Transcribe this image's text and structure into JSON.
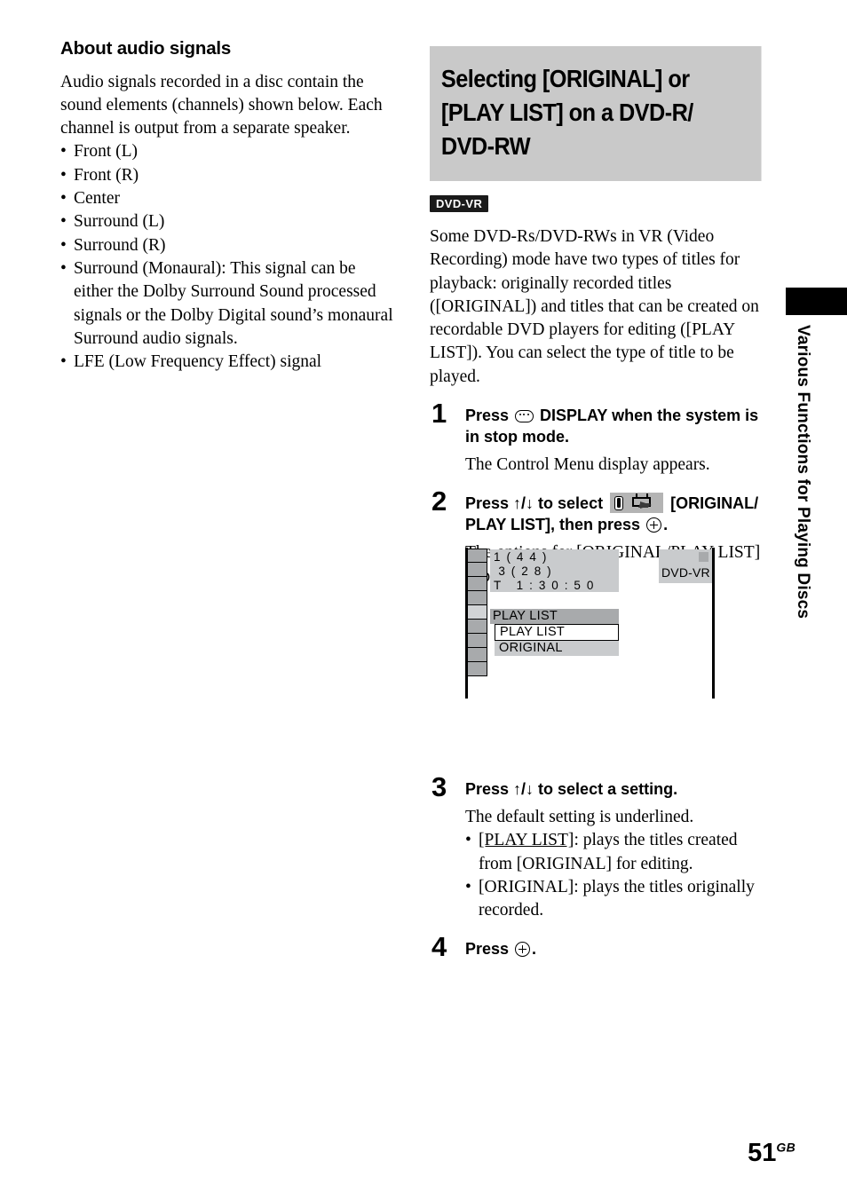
{
  "left_column": {
    "heading": "About audio signals",
    "intro": "Audio signals recorded in a disc contain the sound elements (channels) shown below. Each channel is output from a separate speaker.",
    "channels": [
      "Front (L)",
      "Front (R)",
      "Center",
      "Surround (L)",
      "Surround (R)",
      "Surround (Monaural): This signal can be either the Dolby Surround Sound processed signals or the Dolby Digital sound’s monaural Surround audio signals.",
      "LFE (Low Frequency Effect) signal"
    ]
  },
  "right_column": {
    "section_title": "Selecting [ORIGINAL] or [PLAY LIST] on a DVD-R/ DVD-RW",
    "disc_badge": "DVD-VR",
    "intro": "Some DVD-Rs/DVD-RWs in VR (Video Recording) mode have two types of titles for playback: originally recorded titles ([ORIGINAL]) and titles that can be created on recordable DVD players for editing ([PLAY LIST]). You can select the type of title to be played.",
    "steps": [
      {
        "number": "1",
        "head_before_icon": "Press ",
        "icon": "display-button-icon",
        "head_after_icon": " DISPLAY when the system is in stop mode.",
        "body": "The Control Menu display appears."
      },
      {
        "number": "2",
        "head_part1": "Press ↑/↓ to select ",
        "icon": "original-playlist-icon",
        "head_part2": " [ORIGINAL/ PLAY LIST], then press ",
        "icon2": "enter-button-icon",
        "head_part3": ".",
        "body": "The options for [ORIGINAL/PLAY LIST] appear."
      },
      {
        "number": "3",
        "head": "Press ↑/↓ to select a setting.",
        "body": "The default setting is underlined.",
        "options": [
          {
            "name": "[PLAY LIST]",
            "underlined": true,
            "desc": ": plays the titles created from [ORIGINAL] for editing."
          },
          {
            "name": "[ORIGINAL]",
            "underlined": false,
            "desc": ": plays the titles originally recorded."
          }
        ]
      },
      {
        "number": "4",
        "head_before_icon": "Press ",
        "icon": "enter-button-icon",
        "head_after_icon": "."
      }
    ]
  },
  "osd_figure": {
    "info_lines": [
      "1 ( 4 4 )",
      " 3 ( 2 8 )",
      "T   1 : 3 0 : 5 0"
    ],
    "disc_label": "DVD-VR",
    "current_setting": "PLAY LIST",
    "options": [
      {
        "label": "PLAY LIST",
        "selected": true
      },
      {
        "label": "ORIGINAL",
        "selected": false
      }
    ],
    "icon_cell_count": 9,
    "active_icon_cell_index": 4
  },
  "sidebar": {
    "tab_text": "Various Functions for Playing Discs"
  },
  "page": {
    "number": "51",
    "suffix": "GB"
  },
  "colors": {
    "title_background": "#c9c9c9",
    "osd_panel": "#c9cbcd",
    "osd_cell": "#a8aaac",
    "osd_cell_active": "#d2d4d6",
    "badge_background": "#1a1a1a"
  }
}
